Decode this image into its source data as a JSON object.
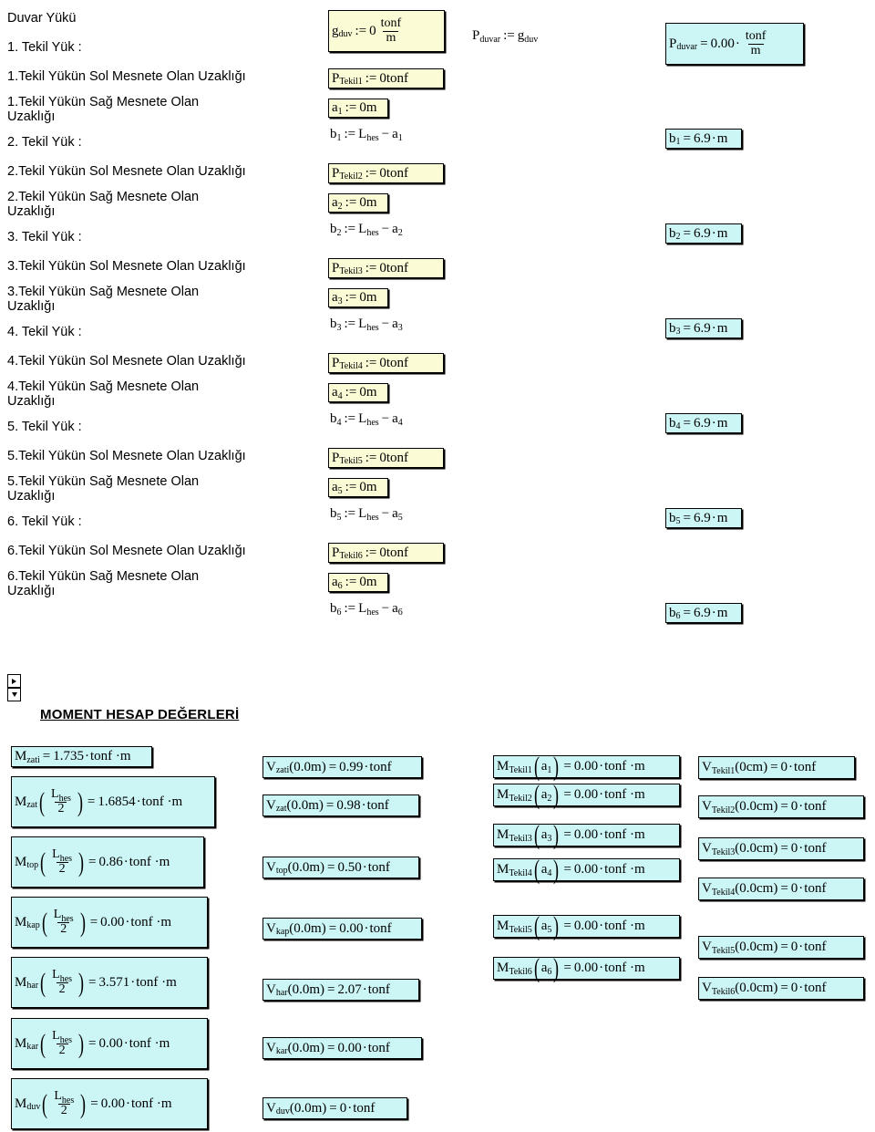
{
  "document": {
    "section1_title": "Duvar Yükü",
    "section2_title": "MOMENT HESAP DEĞERLERİ"
  },
  "labels": {
    "duvar_yuku": "Duvar Yükü",
    "tekil1": "1. Tekil Yük :",
    "tekil1_sol": "1.Tekil Yükün Sol Mesnete Olan Uzaklığı",
    "tekil1_sag": "1.Tekil Yükün Sağ Mesnete Olan\nUzaklığı",
    "tekil2": "2. Tekil Yük :",
    "tekil2_sol": "2.Tekil Yükün Sol Mesnete Olan Uzaklığı",
    "tekil2_sag": "2.Tekil Yükün Sağ Mesnete Olan\nUzaklığı",
    "tekil3": "3. Tekil Yük :",
    "tekil3_sol": "3.Tekil Yükün Sol Mesnete Olan Uzaklığı",
    "tekil3_sag": "3.Tekil Yükün Sağ Mesnete Olan\nUzaklığı",
    "tekil4": "4. Tekil Yük :",
    "tekil4_sol": "4.Tekil Yükün Sol Mesnete Olan Uzaklığı",
    "tekil4_sag": "4.Tekil Yükün Sağ Mesnete Olan\nUzaklığı",
    "tekil5": "5. Tekil Yük :",
    "tekil5_sol": "5.Tekil Yükün Sol Mesnete Olan Uzaklığı",
    "tekil5_sag": "5.Tekil Yükün Sağ Mesnete Olan\nUzaklığı",
    "tekil6": "6. Tekil Yük :",
    "tekil6_sol": "6.Tekil Yükün Sol Mesnete Olan Uzaklığı",
    "tekil6_sag": "6.Tekil Yükün Sağ Mesnete Olan\nUzaklığı"
  },
  "colors": {
    "definition_box": "#fbfbd6",
    "result_box": "#ccf5f5",
    "border": "#000000"
  },
  "expressions": {
    "g_duv": {
      "var": "g",
      "sub": "duv",
      "assign": ":=",
      "value": "0",
      "unit_num": "tonf",
      "unit_den": "m"
    },
    "P_duvar_def": {
      "lhs_var": "P",
      "lhs_sub": "duvar",
      "assign": ":=",
      "rhs_var": "g",
      "rhs_sub": "duv"
    },
    "P_duvar_res": {
      "lhs_var": "P",
      "lhs_sub": "duvar",
      "eq": "=",
      "value": "0.00",
      "mul": "·",
      "unit_num": "tonf",
      "unit_den": "m"
    },
    "P_Tekil": [
      {
        "var": "P",
        "sub": "Tekil1",
        "assign": ":=",
        "value": "0tonf"
      },
      {
        "var": "P",
        "sub": "Tekil2",
        "assign": ":=",
        "value": "0tonf"
      },
      {
        "var": "P",
        "sub": "Tekil3",
        "assign": ":=",
        "value": "0tonf"
      },
      {
        "var": "P",
        "sub": "Tekil4",
        "assign": ":=",
        "value": "0tonf"
      },
      {
        "var": "P",
        "sub": "Tekil5",
        "assign": ":=",
        "value": "0tonf"
      },
      {
        "var": "P",
        "sub": "Tekil6",
        "assign": ":=",
        "value": "0tonf"
      }
    ],
    "a_def": [
      {
        "var": "a",
        "sub": "1",
        "assign": ":=",
        "value": "0m"
      },
      {
        "var": "a",
        "sub": "2",
        "assign": ":=",
        "value": "0m"
      },
      {
        "var": "a",
        "sub": "3",
        "assign": ":=",
        "value": "0m"
      },
      {
        "var": "a",
        "sub": "4",
        "assign": ":=",
        "value": "0m"
      },
      {
        "var": "a",
        "sub": "5",
        "assign": ":=",
        "value": "0m"
      },
      {
        "var": "a",
        "sub": "6",
        "assign": ":=",
        "value": "0m"
      }
    ],
    "b_def": [
      {
        "var": "b",
        "sub": "1",
        "assign": ":=",
        "t1": "L",
        "t1sub": "hes",
        "minus": "−",
        "t2": "a",
        "t2sub": "1"
      },
      {
        "var": "b",
        "sub": "2",
        "assign": ":=",
        "t1": "L",
        "t1sub": "hes",
        "minus": "−",
        "t2": "a",
        "t2sub": "2"
      },
      {
        "var": "b",
        "sub": "3",
        "assign": ":=",
        "t1": "L",
        "t1sub": "hes",
        "minus": "−",
        "t2": "a",
        "t2sub": "3"
      },
      {
        "var": "b",
        "sub": "4",
        "assign": ":=",
        "t1": "L",
        "t1sub": "hes",
        "minus": "−",
        "t2": "a",
        "t2sub": "4"
      },
      {
        "var": "b",
        "sub": "5",
        "assign": ":=",
        "t1": "L",
        "t1sub": "hes",
        "minus": "−",
        "t2": "a",
        "t2sub": "5"
      },
      {
        "var": "b",
        "sub": "6",
        "assign": ":=",
        "t1": "L",
        "t1sub": "hes",
        "minus": "−",
        "t2": "a",
        "t2sub": "6"
      }
    ],
    "b_res": [
      {
        "var": "b",
        "sub": "1",
        "eq": "=",
        "value": "6.9",
        "unit": "m"
      },
      {
        "var": "b",
        "sub": "2",
        "eq": "=",
        "value": "6.9",
        "unit": "m"
      },
      {
        "var": "b",
        "sub": "3",
        "eq": "=",
        "value": "6.9",
        "unit": "m"
      },
      {
        "var": "b",
        "sub": "4",
        "eq": "=",
        "value": "6.9",
        "unit": "m"
      },
      {
        "var": "b",
        "sub": "5",
        "eq": "=",
        "value": "6.9",
        "unit": "m"
      },
      {
        "var": "b",
        "sub": "6",
        "eq": "=",
        "value": "6.9",
        "unit": "m"
      }
    ],
    "moment_simple": {
      "var": "M",
      "sub": "zati",
      "eq": "=",
      "value": "1.735",
      "unit": "tonf ·m"
    },
    "moment_fn": [
      {
        "var": "M",
        "sub": "zat",
        "argnum": "L",
        "argnumsub": "hes",
        "argden": "2",
        "eq": "=",
        "value": "1.6854",
        "unit": "tonf ·m"
      },
      {
        "var": "M",
        "sub": "top",
        "argnum": "L",
        "argnumsub": "hes",
        "argden": "2",
        "eq": "=",
        "value": "0.86",
        "unit": "tonf ·m"
      },
      {
        "var": "M",
        "sub": "kap",
        "argnum": "L",
        "argnumsub": "hes",
        "argden": "2",
        "eq": "=",
        "value": "0.00",
        "unit": "tonf ·m"
      },
      {
        "var": "M",
        "sub": "har",
        "argnum": "L",
        "argnumsub": "hes",
        "argden": "2",
        "eq": "=",
        "value": "3.571",
        "unit": "tonf ·m"
      },
      {
        "var": "M",
        "sub": "kar",
        "argnum": "L",
        "argnumsub": "hes",
        "argden": "2",
        "eq": "=",
        "value": "0.00",
        "unit": "tonf ·m"
      },
      {
        "var": "M",
        "sub": "duv",
        "argnum": "L",
        "argnumsub": "hes",
        "argden": "2",
        "eq": "=",
        "value": "0.00",
        "unit": "tonf ·m"
      }
    ],
    "shear_fn": [
      {
        "var": "V",
        "sub": "zati",
        "arg": "(0.0m)",
        "eq": "=",
        "value": "0.99",
        "unit": "tonf"
      },
      {
        "var": "V",
        "sub": "zat",
        "arg": "(0.0m)",
        "eq": "=",
        "value": "0.98",
        "unit": "tonf"
      },
      {
        "var": "V",
        "sub": "top",
        "arg": "(0.0m)",
        "eq": "=",
        "value": "0.50",
        "unit": "tonf"
      },
      {
        "var": "V",
        "sub": "kap",
        "arg": "(0.0m)",
        "eq": "=",
        "value": "0.00",
        "unit": "tonf"
      },
      {
        "var": "V",
        "sub": "har",
        "arg": "(0.0m)",
        "eq": "=",
        "value": "2.07",
        "unit": "tonf"
      },
      {
        "var": "V",
        "sub": "kar",
        "arg": "(0.0m)",
        "eq": "=",
        "value": "0.00",
        "unit": "tonf"
      },
      {
        "var": "V",
        "sub": "duv",
        "arg": "(0.0m)",
        "eq": "=",
        "value": "0",
        "unit": "tonf"
      }
    ],
    "moment_tekil": [
      {
        "var": "M",
        "sub": "Tekil1",
        "argvar": "a",
        "argsub": "1",
        "eq": "=",
        "value": "0.00",
        "unit": "tonf ·m"
      },
      {
        "var": "M",
        "sub": "Tekil2",
        "argvar": "a",
        "argsub": "2",
        "eq": "=",
        "value": "0.00",
        "unit": "tonf ·m"
      },
      {
        "var": "M",
        "sub": "Tekil3",
        "argvar": "a",
        "argsub": "3",
        "eq": "=",
        "value": "0.00",
        "unit": "tonf ·m"
      },
      {
        "var": "M",
        "sub": "Tekil4",
        "argvar": "a",
        "argsub": "4",
        "eq": "=",
        "value": "0.00",
        "unit": "tonf ·m"
      },
      {
        "var": "M",
        "sub": "Tekil5",
        "argvar": "a",
        "argsub": "5",
        "eq": "=",
        "value": "0.00",
        "unit": "tonf ·m"
      },
      {
        "var": "M",
        "sub": "Tekil6",
        "argvar": "a",
        "argsub": "6",
        "eq": "=",
        "value": "0.00",
        "unit": "tonf ·m"
      }
    ],
    "shear_tekil": [
      {
        "var": "V",
        "sub": "Tekil1",
        "arg": "(0cm)",
        "eq": "=",
        "value": "0",
        "unit": "tonf"
      },
      {
        "var": "V",
        "sub": "Tekil2",
        "arg": "(0.0cm)",
        "eq": "=",
        "value": "0",
        "unit": "tonf"
      },
      {
        "var": "V",
        "sub": "Tekil3",
        "arg": "(0.0cm)",
        "eq": "=",
        "value": "0",
        "unit": "tonf"
      },
      {
        "var": "V",
        "sub": "Tekil4",
        "arg": "(0.0cm)",
        "eq": "=",
        "value": "0",
        "unit": "tonf"
      },
      {
        "var": "V",
        "sub": "Tekil5",
        "arg": "(0.0cm)",
        "eq": "=",
        "value": "0",
        "unit": "tonf"
      },
      {
        "var": "V",
        "sub": "Tekil6",
        "arg": "(0.0cm)",
        "eq": "=",
        "value": "0",
        "unit": "tonf"
      }
    ]
  },
  "controls": {
    "collapse_right": "►",
    "collapse_down": "▼"
  }
}
